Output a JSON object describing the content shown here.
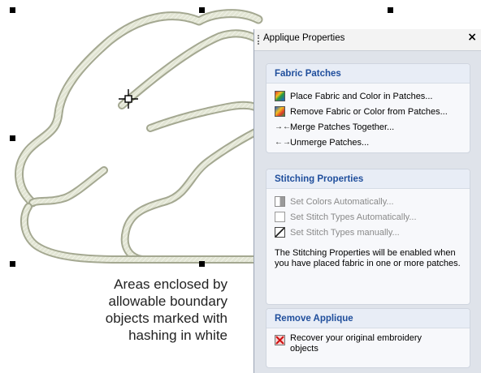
{
  "caption": {
    "lines": [
      "Areas enclosed by",
      "allowable boundary",
      "objects marked with",
      "hashing in white"
    ]
  },
  "panel": {
    "title": "Applique Properties",
    "close_symbol": "×",
    "groups": [
      {
        "heading": "Fabric Patches",
        "items": [
          {
            "label": "Place Fabric and Color in Patches...",
            "icon": "place-fabric-icon",
            "enabled": true
          },
          {
            "label": "Remove Fabric or Color from Patches...",
            "icon": "remove-fabric-icon",
            "enabled": true
          },
          {
            "label": "Merge Patches Together...",
            "icon": "merge-arrows-icon",
            "glyph": "→←",
            "enabled": true
          },
          {
            "label": "Unmerge Patches...",
            "icon": "unmerge-arrows-icon",
            "glyph": "←→",
            "enabled": true
          }
        ]
      },
      {
        "heading": "Stitching Properties",
        "items": [
          {
            "label": "Set Colors Automatically...",
            "icon": "set-colors-icon",
            "enabled": false
          },
          {
            "label": "Set Stitch Types Automatically...",
            "icon": "stitch-types-auto-icon",
            "enabled": false
          },
          {
            "label": "Set Stitch Types manually...",
            "icon": "stitch-types-manual-icon",
            "enabled": false
          }
        ],
        "note": "The Stitching Properties will be enabled when you have placed fabric in one or more patches."
      },
      {
        "heading": "Remove Applique",
        "items": [
          {
            "label": "Recover your original embroidery objects",
            "icon": "recover-icon",
            "enabled": true
          }
        ]
      }
    ]
  },
  "colors": {
    "stitch_fill": "#d8dcc8",
    "stitch_edge": "#9ea38a",
    "group_heading": "#1f4e9c",
    "panel_bg": "#dfe3ea",
    "disabled_text": "#8a8a8a"
  }
}
